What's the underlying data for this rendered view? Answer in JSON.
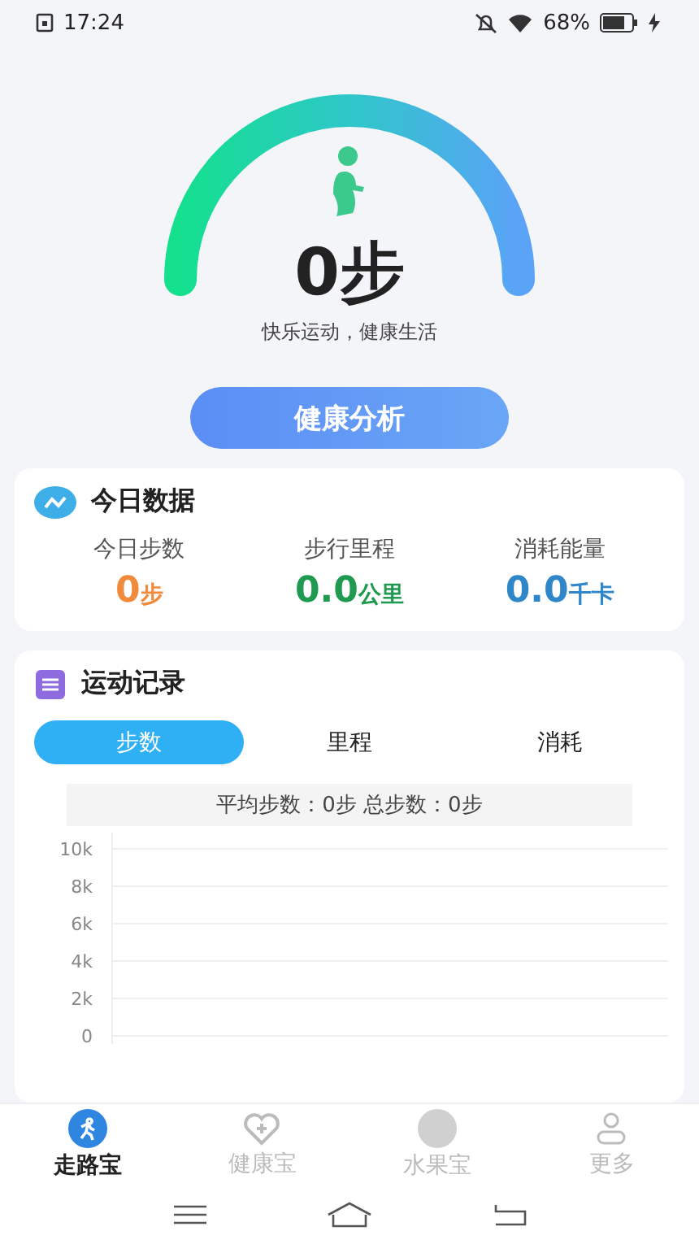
{
  "status_bar": {
    "time": "17:24",
    "battery": "68%"
  },
  "hero": {
    "steps": "0",
    "unit": "步",
    "slogan": "快乐运动，健康生活",
    "button": "健康分析"
  },
  "today": {
    "title": "今日数据",
    "stats": [
      {
        "label": "今日步数",
        "value": "0",
        "unit": "步",
        "color": "#f08a3c"
      },
      {
        "label": "步行里程",
        "value": "0.0",
        "unit": "公里",
        "color": "#1f9a50"
      },
      {
        "label": "消耗能量",
        "value": "0.0",
        "unit": "千卡",
        "color": "#2f86c8"
      }
    ]
  },
  "records": {
    "title": "运动记录",
    "tabs": [
      {
        "label": "步数",
        "selected": true
      },
      {
        "label": "里程",
        "selected": false
      },
      {
        "label": "消耗",
        "selected": false
      }
    ],
    "summary": "平均步数：0步 总步数：0步",
    "chart": {
      "y_labels": [
        "10k",
        "8k",
        "6k",
        "4k",
        "2k",
        "0"
      ]
    }
  },
  "nav": [
    {
      "label": "走路宝",
      "selected": true,
      "kind": "walk"
    },
    {
      "label": "健康宝",
      "selected": false,
      "kind": "health"
    },
    {
      "label": "水果宝",
      "selected": false,
      "kind": "fruit"
    },
    {
      "label": "更多",
      "selected": false,
      "kind": "user"
    }
  ]
}
